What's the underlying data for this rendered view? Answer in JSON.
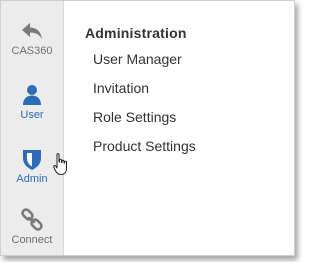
{
  "colors": {
    "sidebar_bg": "#ececec",
    "accent": "#2d6bb6",
    "icon_gray": "#7a7a7a",
    "text": "#333333"
  },
  "sidebar": {
    "items": [
      {
        "label": "CAS360",
        "icon": "back-arrow-icon"
      },
      {
        "label": "User",
        "icon": "user-icon"
      },
      {
        "label": "Admin",
        "icon": "shield-icon"
      },
      {
        "label": "Connect",
        "icon": "link-icon"
      }
    ]
  },
  "main": {
    "heading": "Administration",
    "items": [
      {
        "label": "User Manager"
      },
      {
        "label": "Invitation"
      },
      {
        "label": "Role Settings"
      },
      {
        "label": "Product Settings"
      }
    ]
  }
}
